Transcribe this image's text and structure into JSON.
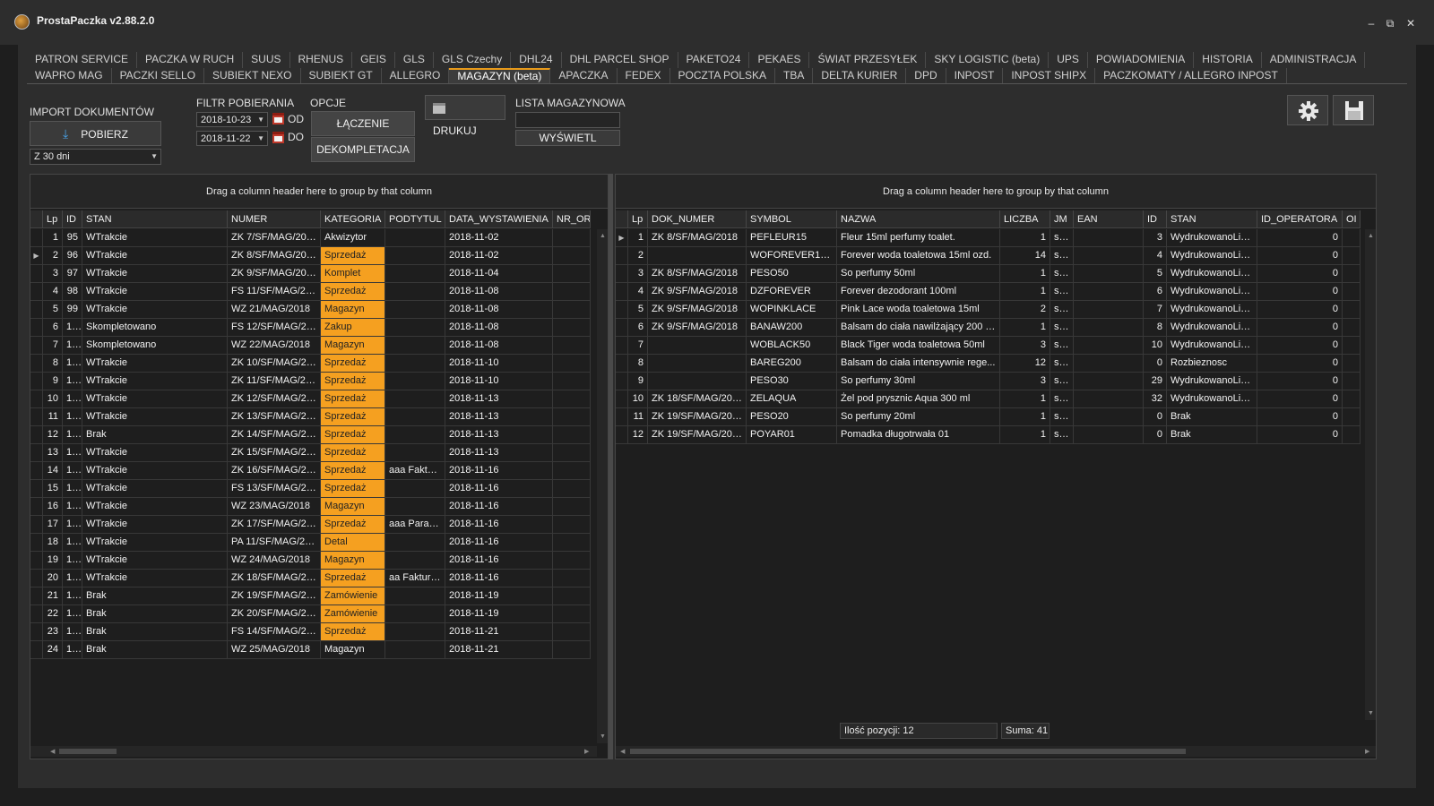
{
  "app": {
    "title": "ProstaPaczka v2.88.2.0"
  },
  "window": {
    "minimize": "–",
    "restore": "⧉",
    "close": "✕"
  },
  "tabs_row1": [
    "PATRON SERVICE",
    "PACZKA W RUCH",
    "SUUS",
    "RHENUS",
    "GEIS",
    "GLS",
    "GLS Czechy",
    "DHL24",
    "DHL PARCEL SHOP",
    "PAKETO24",
    "PEKAES",
    "ŚWIAT PRZESYŁEK",
    "SKY LOGISTIC (beta)",
    "UPS",
    "POWIADOMIENIA",
    "HISTORIA",
    "ADMINISTRACJA"
  ],
  "tabs_row2": [
    "WAPRO MAG",
    "PACZKI SELLO",
    "SUBIEKT NEXO",
    "SUBIEKT GT",
    "ALLEGRO",
    "MAGAZYN (beta)",
    "APACZKA",
    "FEDEX",
    "POCZTA POLSKA",
    "TBA",
    "DELTA KURIER",
    "DPD",
    "INPOST",
    "INPOST SHIPX",
    "PACZKOMATY / ALLEGRO INPOST"
  ],
  "active_tab": "MAGAZYN (beta)",
  "toolbar": {
    "import_label": "IMPORT DOKUMENTÓW",
    "pobierz": "POBIERZ",
    "period": "Z 30 dni",
    "filter_label": "FILTR POBIERANIA",
    "date_from": "2018-10-23",
    "date_to": "2018-11-22",
    "od": "OD",
    "do": "DO",
    "opcje": "OPCJE",
    "laczenie": "ŁĄCZENIE",
    "dekompletacja": "DEKOMPLETACJA",
    "drukuj": "DRUKUJ",
    "lista_label": "LISTA MAGAZYNOWA",
    "lista_value": "",
    "wyswietl": "WYŚWIETL"
  },
  "left_grid": {
    "drag_text": "Drag a column header here to group by that column",
    "columns": [
      "Lp",
      "ID",
      "STAN",
      "NUMER",
      "KATEGORIA",
      "PODTYTUL",
      "DATA_WYSTAWIENIA",
      "NR_OR"
    ],
    "rows": [
      [
        "1",
        "95",
        "WTrakcie",
        "ZK 7/SF/MAG/2018",
        "Akwizytor",
        "",
        "2018-11-02",
        ""
      ],
      [
        "2",
        "96",
        "WTrakcie",
        "ZK 8/SF/MAG/2018",
        "Sprzedaż",
        "",
        "2018-11-02",
        ""
      ],
      [
        "3",
        "97",
        "WTrakcie",
        "ZK 9/SF/MAG/2018",
        "Komplet",
        "",
        "2018-11-04",
        ""
      ],
      [
        "4",
        "98",
        "WTrakcie",
        "FS 11/SF/MAG/20...",
        "Sprzedaż",
        "",
        "2018-11-08",
        ""
      ],
      [
        "5",
        "99",
        "WTrakcie",
        "WZ 21/MAG/2018",
        "Magazyn",
        "",
        "2018-11-08",
        ""
      ],
      [
        "6",
        "1...",
        "Skompletowano",
        "FS 12/SF/MAG/20...",
        "Zakup",
        "",
        "2018-11-08",
        ""
      ],
      [
        "7",
        "1...",
        "Skompletowano",
        "WZ 22/MAG/2018",
        "Magazyn",
        "",
        "2018-11-08",
        ""
      ],
      [
        "8",
        "1...",
        "WTrakcie",
        "ZK 10/SF/MAG/20...",
        "Sprzedaż",
        "",
        "2018-11-10",
        ""
      ],
      [
        "9",
        "1...",
        "WTrakcie",
        "ZK 11/SF/MAG/20...",
        "Sprzedaż",
        "",
        "2018-11-10",
        ""
      ],
      [
        "10",
        "1...",
        "WTrakcie",
        "ZK 12/SF/MAG/20...",
        "Sprzedaż",
        "",
        "2018-11-13",
        ""
      ],
      [
        "11",
        "1...",
        "WTrakcie",
        "ZK 13/SF/MAG/20...",
        "Sprzedaż",
        "",
        "2018-11-13",
        ""
      ],
      [
        "12",
        "1...",
        "Brak",
        "ZK 14/SF/MAG/20...",
        "Sprzedaż",
        "",
        "2018-11-13",
        ""
      ],
      [
        "13",
        "1...",
        "WTrakcie",
        "ZK 15/SF/MAG/20...",
        "Sprzedaż",
        "",
        "2018-11-13",
        ""
      ],
      [
        "14",
        "1...",
        "WTrakcie",
        "ZK 16/SF/MAG/20...",
        "Sprzedaż",
        "aaa Faktur...",
        "2018-11-16",
        ""
      ],
      [
        "15",
        "1...",
        "WTrakcie",
        "FS 13/SF/MAG/20...",
        "Sprzedaż",
        "",
        "2018-11-16",
        ""
      ],
      [
        "16",
        "1...",
        "WTrakcie",
        "WZ 23/MAG/2018",
        "Magazyn",
        "",
        "2018-11-16",
        ""
      ],
      [
        "17",
        "1...",
        "WTrakcie",
        "ZK 17/SF/MAG/20...",
        "Sprzedaż",
        "aaa Parag...",
        "2018-11-16",
        ""
      ],
      [
        "18",
        "1...",
        "WTrakcie",
        "PA 11/SF/MAG/20...",
        "Detal",
        "",
        "2018-11-16",
        ""
      ],
      [
        "19",
        "1...",
        "WTrakcie",
        "WZ 24/MAG/2018",
        "Magazyn",
        "",
        "2018-11-16",
        ""
      ],
      [
        "20",
        "1...",
        "WTrakcie",
        "ZK 18/SF/MAG/20...",
        "Sprzedaż",
        "aa Faktura...",
        "2018-11-16",
        ""
      ],
      [
        "21",
        "1...",
        "Brak",
        "ZK 19/SF/MAG/20...",
        "Zamówienie",
        "",
        "2018-11-19",
        ""
      ],
      [
        "22",
        "1...",
        "Brak",
        "ZK 20/SF/MAG/20...",
        "Zamówienie",
        "",
        "2018-11-19",
        ""
      ],
      [
        "23",
        "1...",
        "Brak",
        "FS 14/SF/MAG/20...",
        "Sprzedaż",
        "",
        "2018-11-21",
        ""
      ],
      [
        "24",
        "1...",
        "Brak",
        "WZ 25/MAG/2018",
        "Magazyn",
        "",
        "2018-11-21",
        ""
      ]
    ],
    "highlighted_rows": [
      1,
      2,
      3,
      4,
      5,
      6,
      7,
      8,
      9,
      10,
      11,
      12,
      13,
      14,
      15,
      16,
      17,
      18,
      19,
      20,
      21,
      22,
      23,
      24
    ],
    "selected_row": 2,
    "highlight_color": "#f5a020"
  },
  "right_grid": {
    "drag_text": "Drag a column header here to group by that column",
    "columns": [
      "Lp",
      "DOK_NUMER",
      "SYMBOL",
      "NAZWA",
      "LICZBA",
      "JM",
      "EAN",
      "ID",
      "STAN",
      "ID_OPERATORA",
      "OI"
    ],
    "rows": [
      [
        "1",
        "ZK 8/SF/MAG/2018",
        "PEFLEUR15",
        "Fleur 15ml perfumy toalet.",
        "1",
        "szt.",
        "",
        "3",
        "WydrukowanoListe",
        "0",
        ""
      ],
      [
        "2",
        "",
        "WOFOREVER15O",
        "Forever woda toaletowa 15ml ozd.",
        "14",
        "szt.",
        "",
        "4",
        "WydrukowanoListe",
        "0",
        ""
      ],
      [
        "3",
        "ZK 8/SF/MAG/2018",
        "PESO50",
        "So perfumy 50ml",
        "1",
        "szt.",
        "",
        "5",
        "WydrukowanoListe",
        "0",
        ""
      ],
      [
        "4",
        "ZK 9/SF/MAG/2018",
        "DZFOREVER",
        "Forever dezodorant 100ml",
        "1",
        "szt.",
        "",
        "6",
        "WydrukowanoListe",
        "0",
        ""
      ],
      [
        "5",
        "ZK 9/SF/MAG/2018",
        "WOPINKLACE",
        "Pink Lace woda toaletowa 15ml",
        "2",
        "szt.",
        "",
        "7",
        "WydrukowanoListe",
        "0",
        ""
      ],
      [
        "6",
        "ZK 9/SF/MAG/2018",
        "BANAW200",
        "Balsam do ciała nawilżający 200 ml",
        "1",
        "szt.",
        "",
        "8",
        "WydrukowanoListe",
        "0",
        ""
      ],
      [
        "7",
        "",
        "WOBLACK50",
        "Black Tiger woda toaletowa 50ml",
        "3",
        "szt.",
        "",
        "10",
        "WydrukowanoListe",
        "0",
        ""
      ],
      [
        "8",
        "",
        "BAREG200",
        "Balsam do ciała intensywnie rege...",
        "12",
        "szt.",
        "",
        "0",
        "Rozbieznosc",
        "0",
        ""
      ],
      [
        "9",
        "",
        "PESO30",
        "So perfumy 30ml",
        "3",
        "szt.",
        "",
        "29",
        "WydrukowanoListe",
        "0",
        ""
      ],
      [
        "10",
        "ZK 18/SF/MAG/2018",
        "ZELAQUA",
        "Żel pod prysznic Aqua 300 ml",
        "1",
        "szt.",
        "",
        "32",
        "WydrukowanoListe",
        "0",
        ""
      ],
      [
        "11",
        "ZK 19/SF/MAG/2018",
        "PESO20",
        "So perfumy 20ml",
        "1",
        "szt.",
        "",
        "0",
        "Brak",
        "0",
        ""
      ],
      [
        "12",
        "ZK 19/SF/MAG/2018",
        "POYAR01",
        "Pomadka długotrwała 01",
        "1",
        "szt.",
        "",
        "0",
        "Brak",
        "0",
        ""
      ]
    ],
    "selected_row": 1,
    "footer_count": "Ilość pozycji: 12",
    "footer_sum": "Suma: 41"
  },
  "icons": {
    "settings": "gear-icon",
    "save": "save-icon",
    "print": "printer-icon",
    "download": "download-icon",
    "calendar": "calendar-icon"
  }
}
